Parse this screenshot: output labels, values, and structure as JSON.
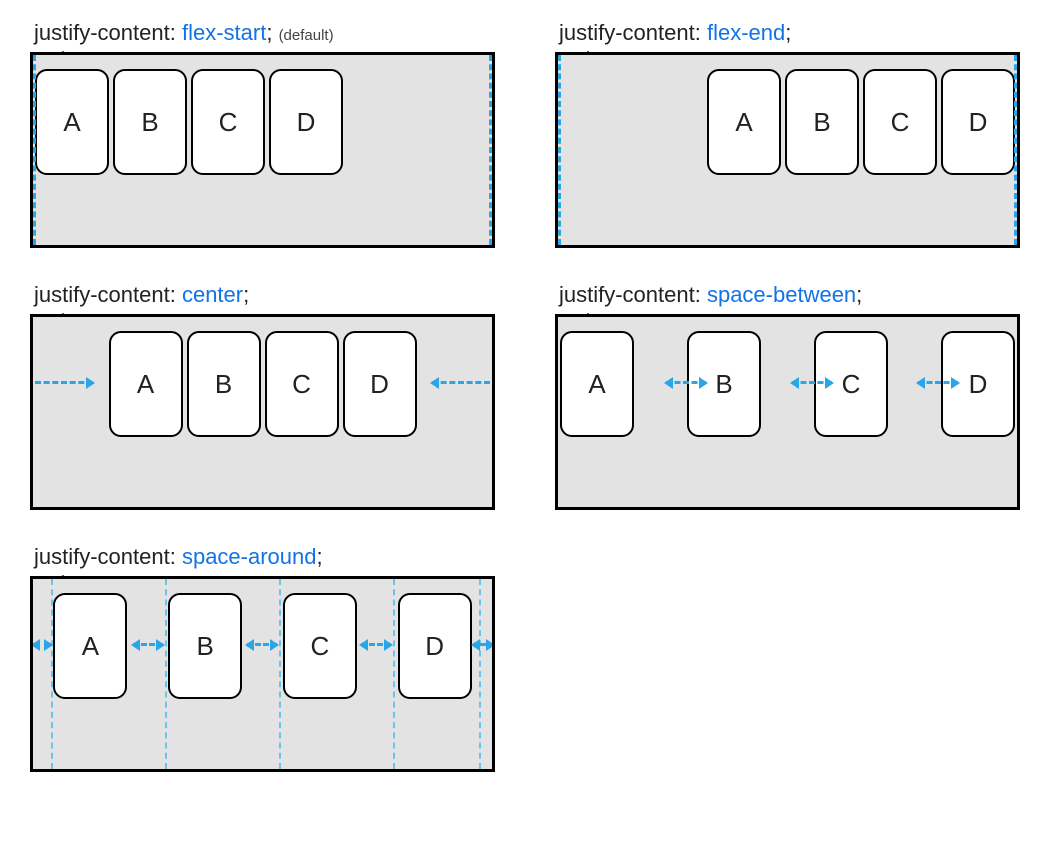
{
  "diagrams": [
    {
      "property": "justify-content:",
      "value": "flex-start",
      "suffix": ";",
      "note": "(default)",
      "justify": "flex-start",
      "items": [
        "A",
        "B",
        "C",
        "D"
      ],
      "decor": "edges"
    },
    {
      "property": "justify-content:",
      "value": "flex-end",
      "suffix": ";",
      "note": "",
      "justify": "flex-end",
      "items": [
        "A",
        "B",
        "C",
        "D"
      ],
      "decor": "edges"
    },
    {
      "property": "justify-content:",
      "value": "center",
      "suffix": ";",
      "note": "",
      "justify": "center",
      "items": [
        "A",
        "B",
        "C",
        "D"
      ],
      "decor": "center-arrows"
    },
    {
      "property": "justify-content:",
      "value": "space-between",
      "suffix": ";",
      "note": "",
      "justify": "space-between",
      "items": [
        "A",
        "B",
        "C",
        "D"
      ],
      "decor": "between-arrows"
    },
    {
      "property": "justify-content:",
      "value": "space-around",
      "suffix": ";",
      "note": "",
      "justify": "space-around",
      "items": [
        "A",
        "B",
        "C",
        "D"
      ],
      "decor": "around-guides"
    }
  ]
}
